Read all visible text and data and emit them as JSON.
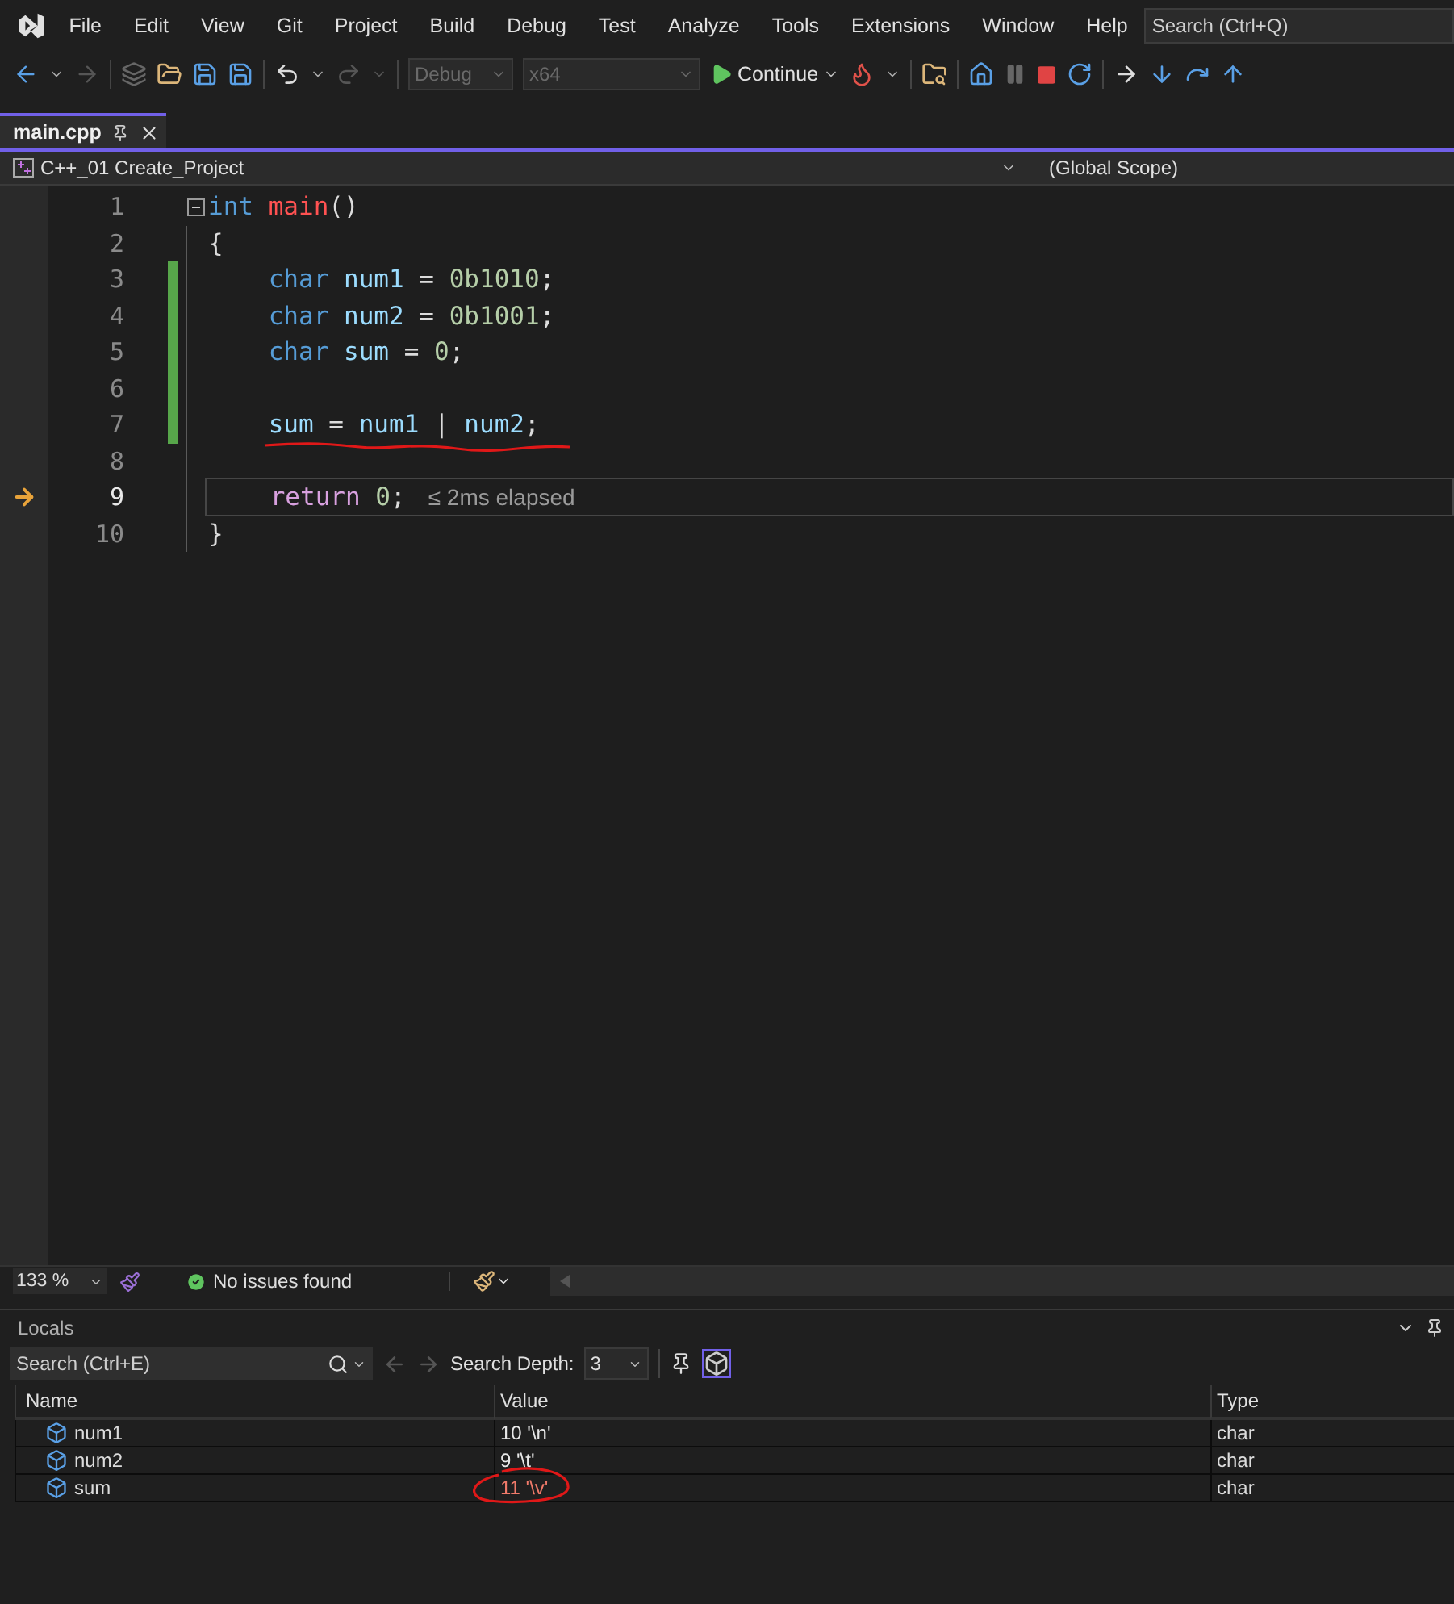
{
  "menu": [
    "File",
    "Edit",
    "View",
    "Git",
    "Project",
    "Build",
    "Debug",
    "Test",
    "Analyze",
    "Tools",
    "Extensions",
    "Window",
    "Help"
  ],
  "search": {
    "placeholder": "Search (Ctrl+Q)"
  },
  "toolbar": {
    "configuration": "Debug",
    "platform": "x64",
    "continue": "Continue"
  },
  "tabs": [
    {
      "label": "main.cpp",
      "selected": true
    }
  ],
  "nav": {
    "project": "C++_01 Create_Project",
    "scope": "(Global Scope)"
  },
  "code_lines": [
    {
      "number": "1",
      "fold": true,
      "changed": false,
      "current": false,
      "underlined": false,
      "tokens": [
        {
          "text": "int",
          "kind": "keyword"
        },
        {
          "text": " main",
          "kind": "function"
        },
        {
          "text": "()",
          "kind": "plain"
        }
      ]
    },
    {
      "number": "2",
      "fold": false,
      "changed": false,
      "current": false,
      "underlined": false,
      "tokens": [
        {
          "text": "{",
          "kind": "plain"
        }
      ]
    },
    {
      "number": "3",
      "fold": false,
      "changed": true,
      "current": false,
      "underlined": false,
      "tokens": [
        {
          "text": "    char",
          "kind": "keyword"
        },
        {
          "text": " num1",
          "kind": "variable"
        },
        {
          "text": " = ",
          "kind": "plain"
        },
        {
          "text": "0b1010",
          "kind": "number"
        },
        {
          "text": ";",
          "kind": "plain"
        }
      ]
    },
    {
      "number": "4",
      "fold": false,
      "changed": true,
      "current": false,
      "underlined": false,
      "tokens": [
        {
          "text": "    char",
          "kind": "keyword"
        },
        {
          "text": " num2",
          "kind": "variable"
        },
        {
          "text": " = ",
          "kind": "plain"
        },
        {
          "text": "0b1001",
          "kind": "number"
        },
        {
          "text": ";",
          "kind": "plain"
        }
      ]
    },
    {
      "number": "5",
      "fold": false,
      "changed": true,
      "current": false,
      "underlined": false,
      "tokens": [
        {
          "text": "    char",
          "kind": "keyword"
        },
        {
          "text": " sum",
          "kind": "variable"
        },
        {
          "text": " = ",
          "kind": "plain"
        },
        {
          "text": "0",
          "kind": "number"
        },
        {
          "text": ";",
          "kind": "plain"
        }
      ]
    },
    {
      "number": "6",
      "fold": false,
      "changed": true,
      "current": false,
      "underlined": false
    },
    {
      "number": "7",
      "fold": false,
      "changed": true,
      "current": false,
      "underlined": true,
      "tokens": [
        {
          "text": "    sum",
          "kind": "variable"
        },
        {
          "text": " = ",
          "kind": "plain"
        },
        {
          "text": "num1",
          "kind": "variable"
        },
        {
          "text": " | ",
          "kind": "plain"
        },
        {
          "text": "num2",
          "kind": "variable"
        },
        {
          "text": ";",
          "kind": "plain"
        }
      ]
    },
    {
      "number": "8",
      "fold": false,
      "changed": false,
      "current": false,
      "underlined": false
    },
    {
      "number": "9",
      "fold": false,
      "changed": false,
      "current": true,
      "underlined": false,
      "hint": "≤ 2ms elapsed",
      "tokens": [
        {
          "text": "    return",
          "kind": "control"
        },
        {
          "text": " 0",
          "kind": "number"
        },
        {
          "text": ";",
          "kind": "plain"
        }
      ]
    },
    {
      "number": "10",
      "fold": false,
      "changed": false,
      "current": false,
      "underlined": false,
      "tokens": [
        {
          "text": "}",
          "kind": "plain"
        }
      ]
    }
  ],
  "status_bar": {
    "zoom": "133 %",
    "issues": "No issues found"
  },
  "locals": {
    "title": "Locals",
    "search_placeholder": "Search (Ctrl+E)",
    "depth_label": "Search Depth:",
    "depth": "3",
    "columns": [
      "Name",
      "Value",
      "Type"
    ],
    "rows": [
      {
        "name": "num1",
        "value": "10 '\\n'",
        "type": "char",
        "changed": false,
        "circled": false
      },
      {
        "name": "num2",
        "value": "9 '\\t'",
        "type": "char",
        "changed": false,
        "circled": false
      },
      {
        "name": "sum",
        "value": "11 '\\v'",
        "type": "char",
        "changed": true,
        "circled": true
      }
    ]
  }
}
